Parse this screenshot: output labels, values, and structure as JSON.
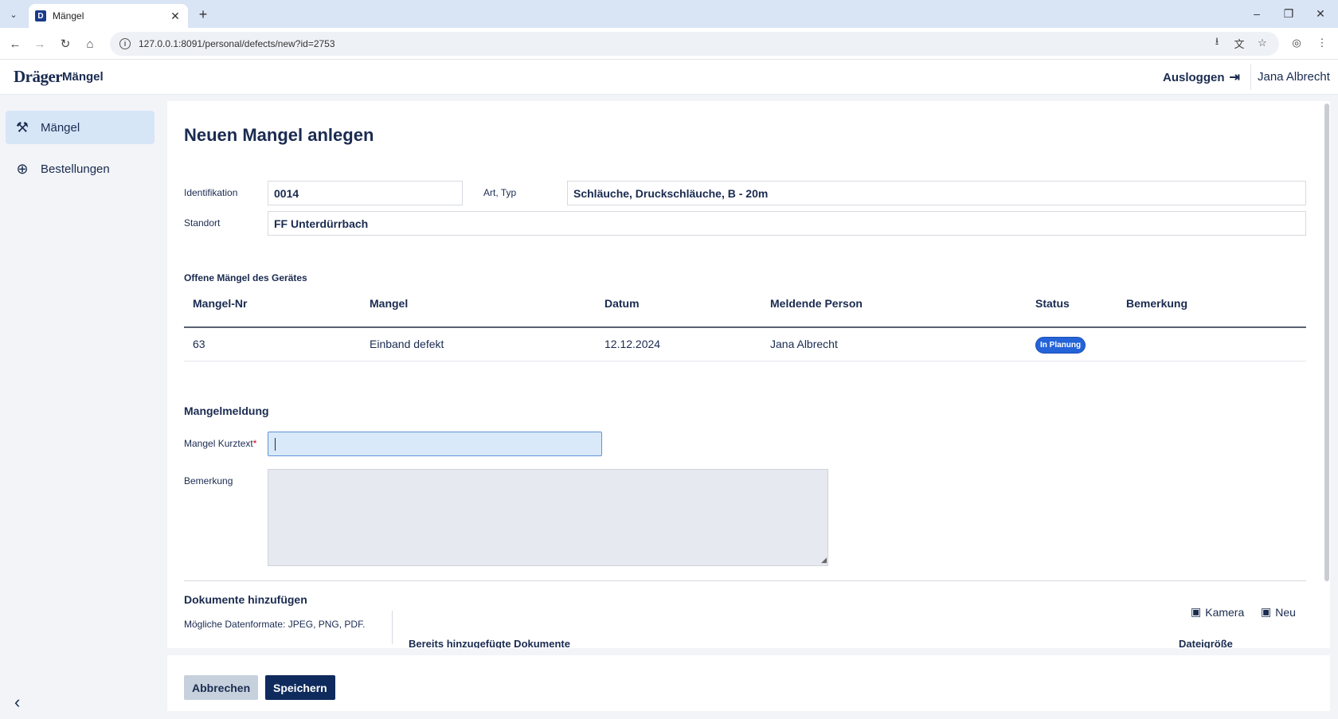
{
  "browser": {
    "tab_title": "Mängel",
    "favicon_letter": "D",
    "url": "127.0.0.1:8091/personal/defects/new?id=2753"
  },
  "header": {
    "logo": "Dräger",
    "app_title": "Mängel",
    "logout_label": "Ausloggen",
    "user_name": "Jana Albrecht"
  },
  "sidebar": {
    "items": [
      {
        "label": "Mängel",
        "icon": "tools-icon",
        "active": true
      },
      {
        "label": "Bestellungen",
        "icon": "globe-icon",
        "active": false
      }
    ]
  },
  "form": {
    "title": "Neuen Mangel anlegen",
    "identifikation_label": "Identifikation",
    "identifikation_value": "0014",
    "art_typ_label": "Art, Typ",
    "art_typ_value": "Schläuche, Druckschläuche, B - 20m",
    "standort_label": "Standort",
    "standort_value": "FF Unterdürrbach"
  },
  "open_defects": {
    "heading": "Offene Mängel des Gerätes",
    "columns": [
      "Mangel-Nr",
      "Mangel",
      "Datum",
      "Meldende Person",
      "Status",
      "Bemerkung"
    ],
    "rows": [
      {
        "nr": "63",
        "mangel": "Einband defekt",
        "datum": "12.12.2024",
        "person": "Jana Albrecht",
        "status": "In Planung",
        "bemerkung": ""
      }
    ]
  },
  "report": {
    "heading": "Mangelmeldung",
    "kurztext_label": "Mangel Kurztext",
    "required_mark": "*",
    "kurztext_value": "",
    "bemerkung_label": "Bemerkung",
    "bemerkung_value": ""
  },
  "documents": {
    "heading": "Dokumente hinzufügen",
    "formats_text": "Mögliche Datenformate: JPEG, PNG, PDF.",
    "camera_label": "Kamera",
    "new_label": "Neu",
    "added_heading": "Bereits hinzugefügte Dokumente",
    "size_heading": "Dateigröße"
  },
  "footer": {
    "cancel_label": "Abbrechen",
    "save_label": "Speichern"
  },
  "colors": {
    "primary": "#0f2a5c",
    "badge": "#2463d8",
    "active_nav": "#d7e6f7",
    "input_focus": "#d9e9f9"
  }
}
